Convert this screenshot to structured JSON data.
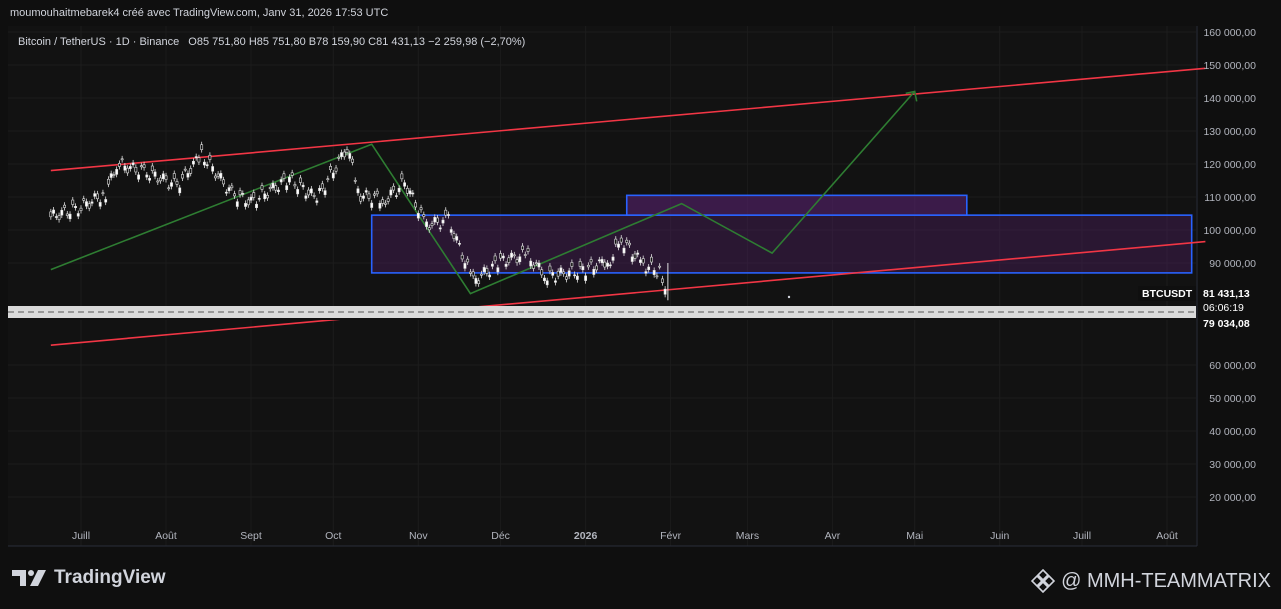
{
  "header": {
    "author_line": "moumouhaitmebarek4 créé avec TradingView.com, Janv 31, 2026 17:53 UTC"
  },
  "symbol": {
    "name": "Bitcoin / TetherUS · 1D · Binance",
    "open_label": "O",
    "open": "85 751,80",
    "high_label": "H",
    "high": "85 751,80",
    "low_label": "B",
    "low": "78 159,90",
    "close_label": "C",
    "close": "81 431,13",
    "change": "−2 259,98 (−2,70%)"
  },
  "price_tag": {
    "ticker": "BTCUSDT",
    "price": "81 431,13",
    "countdown": "06:06:19",
    "low_marker": "79 034,08"
  },
  "footer": {
    "logo_text": "TradingView",
    "watermark": "@ MMH-TEAMMATRIX"
  },
  "colors": {
    "background": "#0f0f0f",
    "red_channel": "#f23645",
    "green_path": "#2e7d32",
    "blue_zone": "#2962ff",
    "zone_fill": "#4a1f5c"
  },
  "chart_data": {
    "type": "candlestick",
    "title": "",
    "ylabel": "",
    "y_ticks": [
      "160 000,00",
      "150 000,00",
      "140 000,00",
      "130 000,00",
      "120 000,00",
      "110 000,00",
      "100 000,00",
      "90 000,00",
      "60 000,00",
      "50 000,00",
      "40 000,00",
      "30 000,00",
      "20 000,00"
    ],
    "y_tick_values": [
      160000,
      150000,
      140000,
      130000,
      120000,
      110000,
      100000,
      90000,
      60000,
      50000,
      40000,
      30000,
      20000
    ],
    "x_ticks": [
      "Juill",
      "Août",
      "Sept",
      "Oct",
      "Nov",
      "Déc",
      "2026",
      "Févr",
      "Mars",
      "Avr",
      "Mai",
      "Juin",
      "Juill",
      "Août"
    ],
    "x_tick_dates": [
      "2025-07-01",
      "2025-08-01",
      "2025-09-01",
      "2025-10-01",
      "2025-11-01",
      "2025-12-01",
      "2026-01-01",
      "2026-02-01",
      "2026-03-01",
      "2026-04-01",
      "2026-05-01",
      "2026-06-01",
      "2026-07-01",
      "2026-08-01"
    ],
    "ylim": [
      13000,
      163000
    ],
    "grid": true,
    "price_series": [
      {
        "date": "2025-06-20",
        "close": 104000
      },
      {
        "date": "2025-07-01",
        "close": 107000
      },
      {
        "date": "2025-07-10",
        "close": 111000
      },
      {
        "date": "2025-07-14",
        "close": 120000
      },
      {
        "date": "2025-07-25",
        "close": 117500
      },
      {
        "date": "2025-08-05",
        "close": 113500
      },
      {
        "date": "2025-08-14",
        "close": 123000
      },
      {
        "date": "2025-08-25",
        "close": 111000
      },
      {
        "date": "2025-09-01",
        "close": 108500
      },
      {
        "date": "2025-09-15",
        "close": 115500
      },
      {
        "date": "2025-09-25",
        "close": 109500
      },
      {
        "date": "2025-10-06",
        "close": 125000
      },
      {
        "date": "2025-10-11",
        "close": 110500
      },
      {
        "date": "2025-10-20",
        "close": 109000
      },
      {
        "date": "2025-10-27",
        "close": 114500
      },
      {
        "date": "2025-11-04",
        "close": 101500
      },
      {
        "date": "2025-11-12",
        "close": 103000
      },
      {
        "date": "2025-11-21",
        "close": 84500
      },
      {
        "date": "2025-12-01",
        "close": 90500
      },
      {
        "date": "2025-12-10",
        "close": 92500
      },
      {
        "date": "2025-12-18",
        "close": 86000
      },
      {
        "date": "2026-01-01",
        "close": 88000
      },
      {
        "date": "2026-01-10",
        "close": 91000
      },
      {
        "date": "2026-01-14",
        "close": 97000
      },
      {
        "date": "2026-01-22",
        "close": 89500
      },
      {
        "date": "2026-01-28",
        "close": 87500
      },
      {
        "date": "2026-01-31",
        "close": 81431.13
      }
    ],
    "projected_path": [
      {
        "date": "2025-06-20",
        "value": 88000
      },
      {
        "date": "2025-10-15",
        "value": 126000
      },
      {
        "date": "2025-11-20",
        "value": 81000
      },
      {
        "date": "2026-02-05",
        "value": 108000
      },
      {
        "date": "2026-03-10",
        "value": 93000
      },
      {
        "date": "2026-05-01",
        "value": 142000
      }
    ],
    "channel_upper": [
      {
        "date": "2025-06-20",
        "value": 118000
      },
      {
        "date": "2026-08-15",
        "value": 149000
      }
    ],
    "channel_lower": [
      {
        "date": "2025-06-20",
        "value": 66000
      },
      {
        "date": "2026-08-15",
        "value": 96500
      }
    ],
    "zones": [
      {
        "start": "2025-10-15",
        "end": "2026-08-10",
        "top": 104500,
        "bottom": 87000
      },
      {
        "start": "2026-01-16",
        "end": "2026-05-20",
        "top": 110500,
        "bottom": 104500
      }
    ]
  }
}
